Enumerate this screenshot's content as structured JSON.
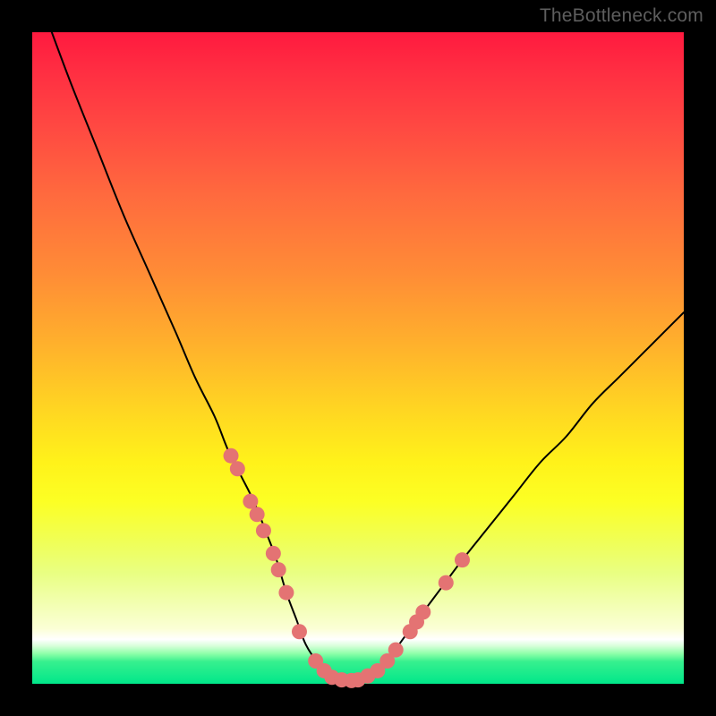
{
  "watermark": "TheBottleneck.com",
  "colors": {
    "frame": "#000000",
    "line": "#000000",
    "dot": "#e47373"
  },
  "chart_data": {
    "type": "line",
    "title": "",
    "xlabel": "",
    "ylabel": "",
    "xlim": [
      0,
      100
    ],
    "ylim": [
      0,
      100
    ],
    "series": [
      {
        "name": "curve",
        "x": [
          3,
          6,
          10,
          14,
          18,
          22,
          25,
          28,
          30,
          32,
          34,
          36,
          37.5,
          39,
          40.5,
          42,
          44,
          46,
          48.5,
          51,
          54,
          57,
          60,
          63,
          66,
          70,
          74,
          78,
          82,
          86,
          90,
          94,
          98,
          100
        ],
        "y": [
          100,
          92,
          82,
          72,
          63,
          54,
          47,
          41,
          36,
          32,
          28,
          23,
          19,
          14,
          10,
          6,
          3,
          1,
          0.5,
          1,
          3,
          7,
          11,
          15,
          19,
          24,
          29,
          34,
          38,
          43,
          47,
          51,
          55,
          57
        ]
      }
    ],
    "markers": [
      {
        "x": 30.5,
        "y": 35
      },
      {
        "x": 31.5,
        "y": 33
      },
      {
        "x": 33.5,
        "y": 28
      },
      {
        "x": 34.5,
        "y": 26
      },
      {
        "x": 35.5,
        "y": 23.5
      },
      {
        "x": 37,
        "y": 20
      },
      {
        "x": 37.8,
        "y": 17.5
      },
      {
        "x": 39,
        "y": 14
      },
      {
        "x": 41,
        "y": 8
      },
      {
        "x": 43.5,
        "y": 3.5
      },
      {
        "x": 44.8,
        "y": 2
      },
      {
        "x": 46,
        "y": 1
      },
      {
        "x": 47.5,
        "y": 0.6
      },
      {
        "x": 49,
        "y": 0.5
      },
      {
        "x": 50,
        "y": 0.6
      },
      {
        "x": 51.5,
        "y": 1.2
      },
      {
        "x": 53,
        "y": 2
      },
      {
        "x": 54.5,
        "y": 3.5
      },
      {
        "x": 55.8,
        "y": 5.2
      },
      {
        "x": 58,
        "y": 8
      },
      {
        "x": 59,
        "y": 9.5
      },
      {
        "x": 60,
        "y": 11
      },
      {
        "x": 63.5,
        "y": 15.5
      },
      {
        "x": 66,
        "y": 19
      }
    ]
  }
}
